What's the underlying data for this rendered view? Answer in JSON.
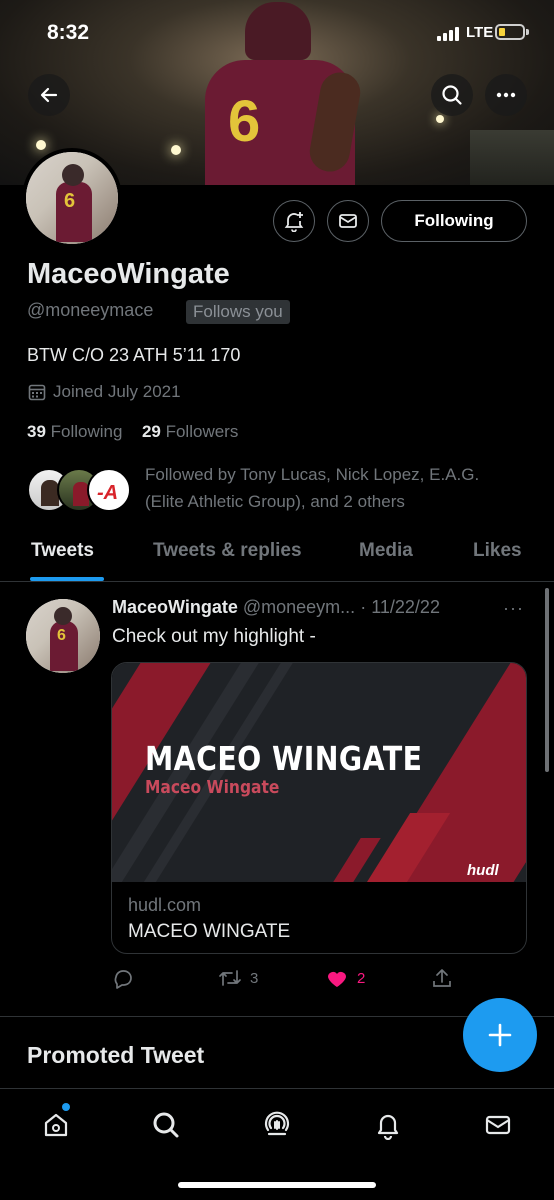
{
  "status_bar": {
    "time": "8:32",
    "network": "LTE"
  },
  "header": {
    "back_icon": "back-arrow-icon",
    "search_icon": "search-icon",
    "more_icon": "more-icon"
  },
  "profile": {
    "display_name": "MaceoWingate",
    "handle": "@moneeymace",
    "follows_you": "Follows you",
    "bio": "BTW C/O 23 ATH 5’11 170",
    "joined": "Joined July 2021",
    "following_count": "39",
    "following_label": "Following",
    "followers_count": "29",
    "followers_label": "Followers",
    "followed_by": "Followed by Tony Lucas, Nick Lopez, E.A.G. (Elite Athletic Group), and 2 others",
    "following_button": "Following"
  },
  "tabs": [
    {
      "label": "Tweets",
      "active": true
    },
    {
      "label": "Tweets & replies",
      "active": false
    },
    {
      "label": "Media",
      "active": false
    },
    {
      "label": "Likes",
      "active": false
    }
  ],
  "tweet": {
    "author_name": "MaceoWingate",
    "author_handle": "@moneeym...",
    "separator": "·",
    "date": "11/22/22",
    "text": "Check out my highlight -",
    "card": {
      "title": "MACEO WINGATE",
      "subtitle": "Maceo Wingate",
      "brand": "hudl",
      "domain": "hudl.com",
      "caption": "MACEO WINGATE"
    },
    "retweets": "3",
    "likes": "2"
  },
  "promoted": "Promoted Tweet",
  "colors": {
    "accent": "#1d9bf0",
    "like": "#f91880",
    "background": "#000000"
  },
  "nav": [
    "home-icon",
    "search-icon",
    "spaces-icon",
    "notifications-icon",
    "messages-icon"
  ]
}
